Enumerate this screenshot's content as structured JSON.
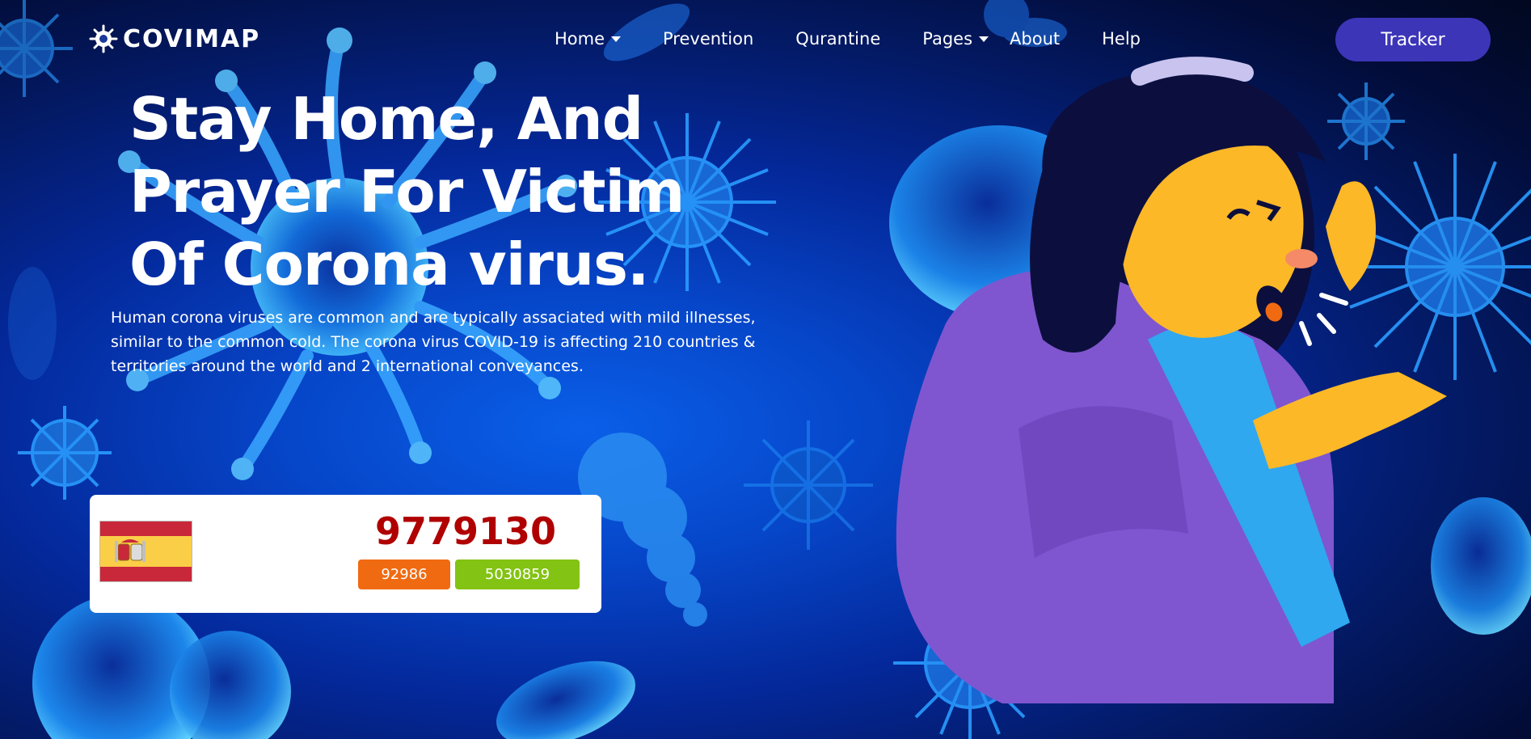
{
  "brand": {
    "name": "COVIMAP",
    "logo_icon": "virus-icon"
  },
  "nav": {
    "items": [
      {
        "label": "Home",
        "dropdown": true
      },
      {
        "label": "Prevention",
        "dropdown": false
      },
      {
        "label": "Qurantine",
        "dropdown": false
      },
      {
        "label": "Pages",
        "dropdown": true
      },
      {
        "label": "About",
        "dropdown": false
      },
      {
        "label": "Help",
        "dropdown": false
      }
    ],
    "cta_label": "Tracker"
  },
  "hero": {
    "title_line1": "Stay Home, And",
    "title_line2": "Prayer For Victim",
    "title_line3": "Of Corona virus.",
    "description": "Human corona viruses are common and are typically assaciated with mild illnesses, similar to the common cold. The corona virus COVID-19 is affecting 210 countries & territories around the world and 2 international conveyances."
  },
  "stats": {
    "country_flag": "spain-flag",
    "total": "9779130",
    "deaths": "92986",
    "recovered": "5030859"
  },
  "colors": {
    "cta": "#3c35b8",
    "total_text": "#b00000",
    "deaths_badge": "#f06a12",
    "recovered_badge": "#83c313"
  }
}
